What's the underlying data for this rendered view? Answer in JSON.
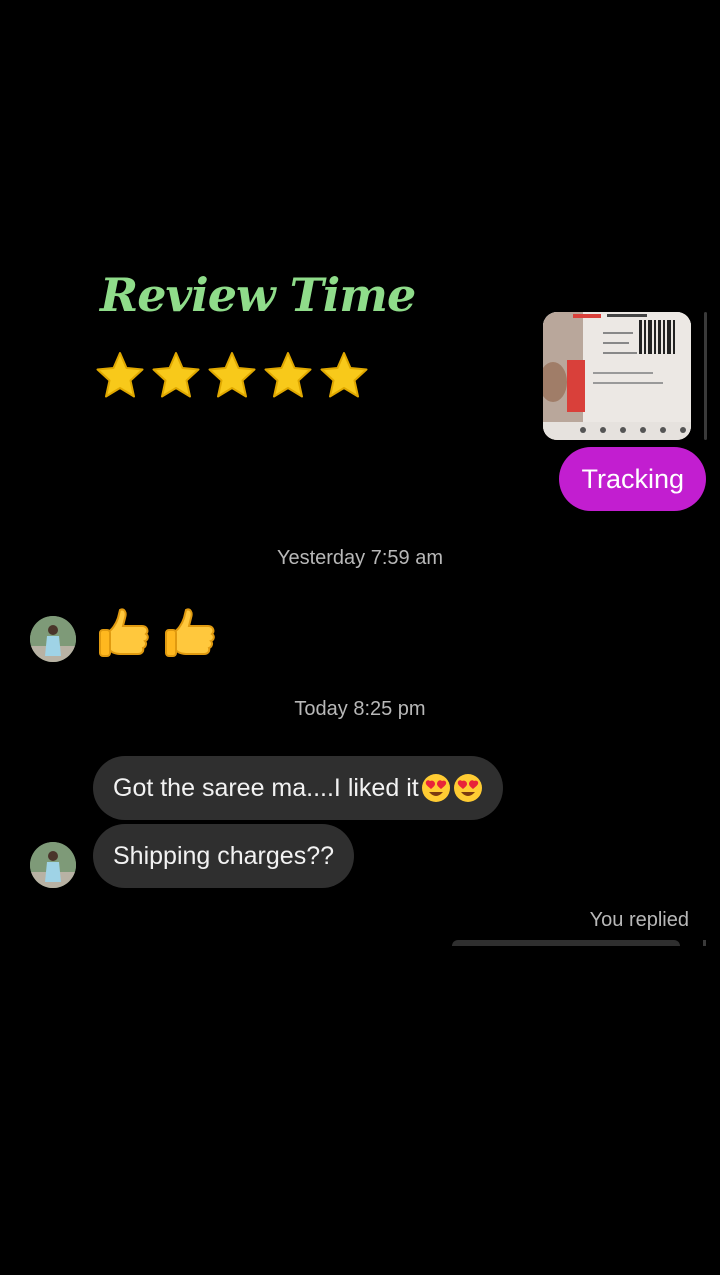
{
  "story_overlay": {
    "title": "Review Time",
    "star_rating": 5,
    "star_color": "#f8c91a",
    "title_color": "#8fdc8a"
  },
  "chat": {
    "shared_image": {
      "icon": "shipping-label-photo"
    },
    "outgoing_message": "Tracking",
    "outgoing_bubble_color": "#c21ed0",
    "timestamp_1": "Yesterday 7:59 am",
    "reaction_emojis": [
      "thumbs-up",
      "thumbs-up"
    ],
    "timestamp_2": "Today 8:25 pm",
    "incoming_messages": [
      {
        "text": "Got the saree ma....I liked it",
        "emojis": [
          "heart-eyes",
          "heart-eyes"
        ]
      },
      {
        "text": "Shipping charges??"
      }
    ],
    "incoming_bubble_color": "#2f2f2f",
    "you_replied_label": "You replied"
  }
}
